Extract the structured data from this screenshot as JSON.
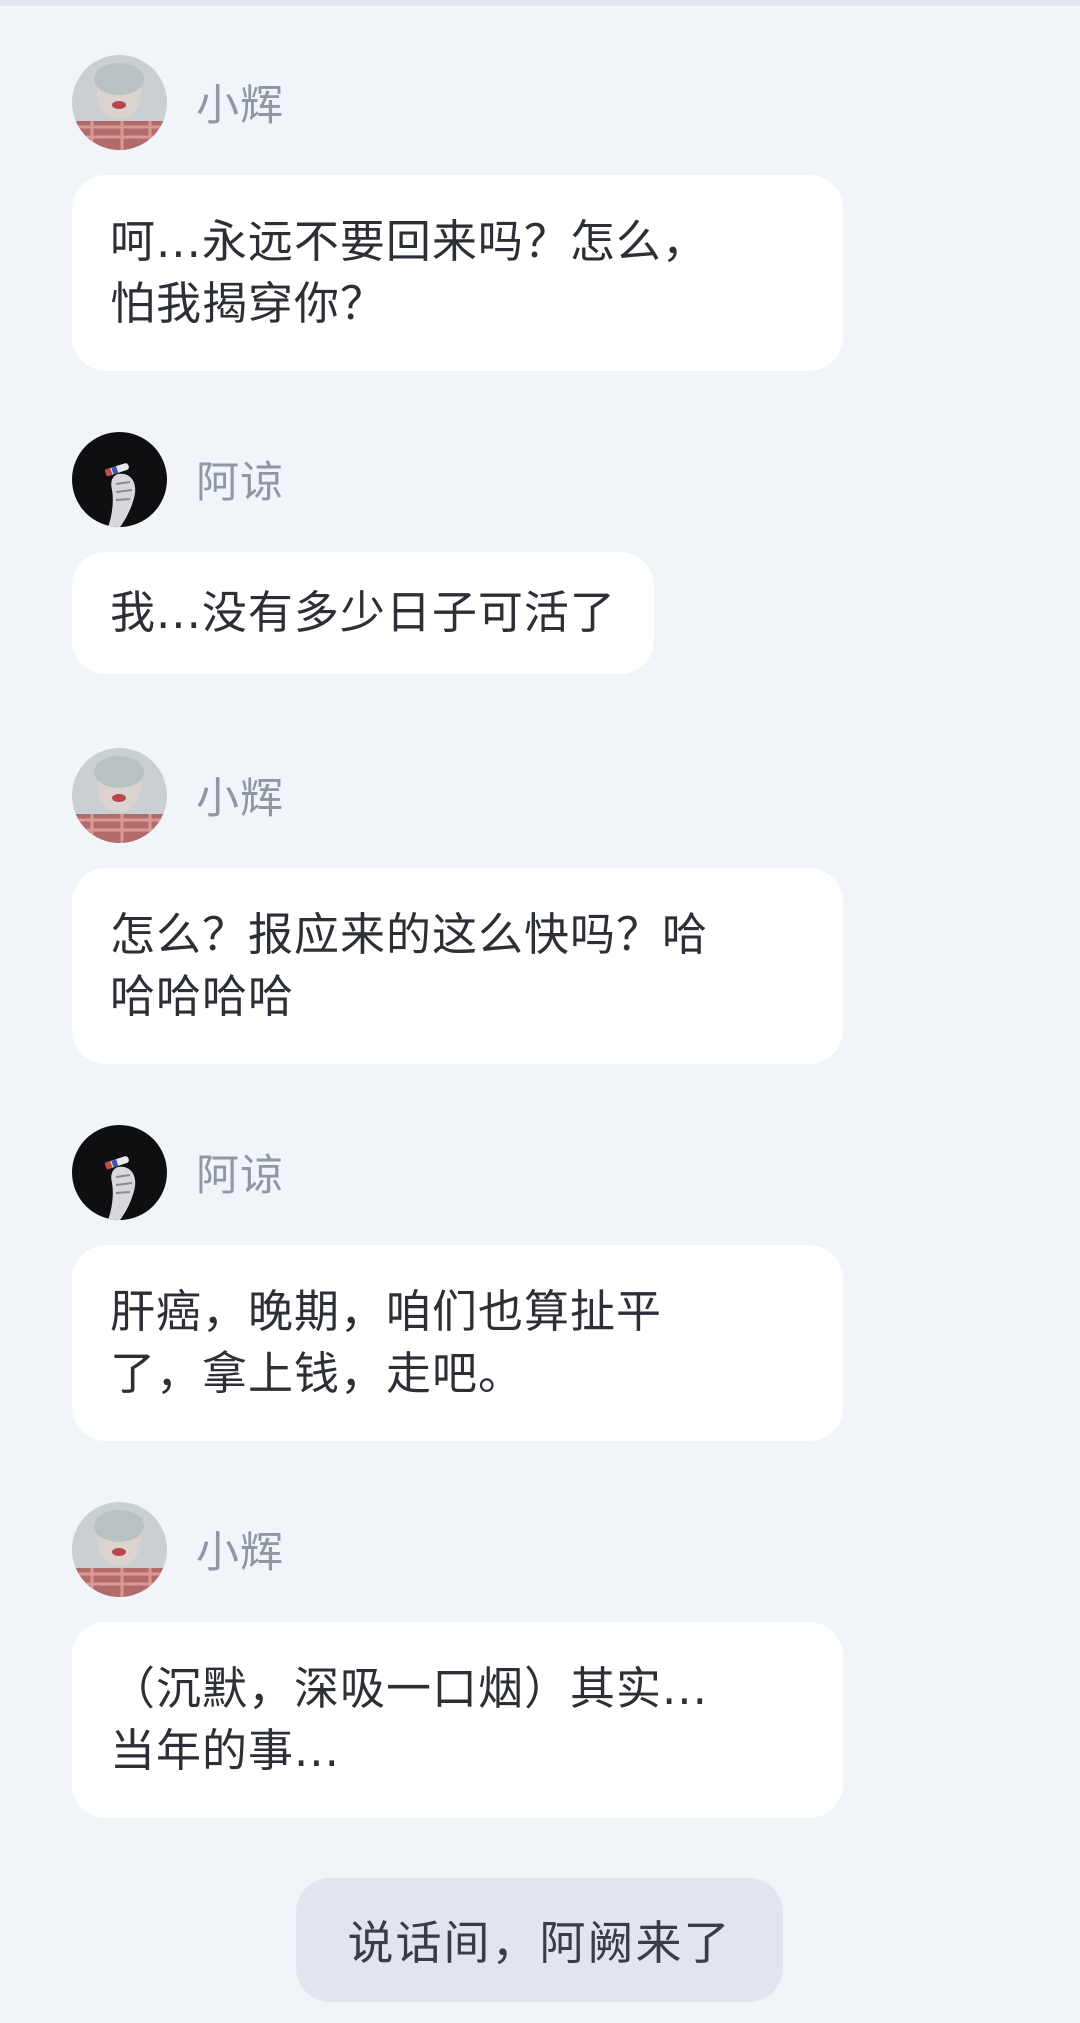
{
  "messages": [
    {
      "sender": "小辉",
      "avatar": "xiaohui-avatar",
      "text": "呵...永远不要回来吗？怎么，\n怕我揭穿你？"
    },
    {
      "sender": "阿谅",
      "avatar": "aliang-avatar",
      "text": "我...没有多少日子可活了"
    },
    {
      "sender": "小辉",
      "avatar": "xiaohui-avatar",
      "text": "怎么？报应来的这么快吗？哈\n哈哈哈哈"
    },
    {
      "sender": "阿谅",
      "avatar": "aliang-avatar",
      "text": "肝癌，晚期，咱们也算扯平\n了，拿上钱，走吧。"
    },
    {
      "sender": "小辉",
      "avatar": "xiaohui-avatar",
      "text": "（沉默，深吸一口烟）其实...\n当年的事..."
    }
  ],
  "narration": "说话间，阿阙来了",
  "colors": {
    "background": "#f1f4f9",
    "bubble": "#ffffff",
    "narration_bubble": "#e2e5eb",
    "sender_name": "#8e97a3",
    "text": "#2c2f36"
  }
}
